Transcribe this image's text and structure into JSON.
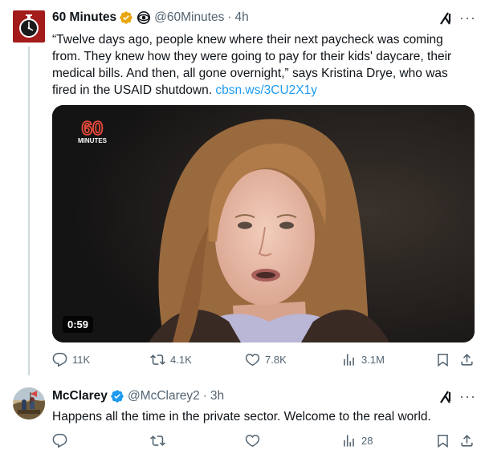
{
  "tweets": [
    {
      "display_name": "60 Minutes",
      "handle": "@60Minutes",
      "separator": "·",
      "time": "4h",
      "text": "“Twelve days ago, people knew where their next paycheck was coming from. They knew how they were going to pay for their kids' daycare, their medical bills. And then, all gone overnight,” says Kristina Drye, who was fired in the USAID shutdown. ",
      "link": "cbsn.ws/3CU2X1y",
      "video": {
        "duration": "0:59",
        "brand_line1": "60",
        "brand_line2": "MINUTES"
      },
      "stats": {
        "replies": "11K",
        "reposts": "4.1K",
        "likes": "7.8K",
        "views": "3.1M"
      },
      "badge_color": "#e8a711",
      "avatar_icon": "stopwatch-logo"
    },
    {
      "display_name": "McClarey",
      "handle": "@McClarey2",
      "separator": "·",
      "time": "3h",
      "text": "Happens all the time in the private sector.  Welcome to the real world.",
      "stats": {
        "replies": "",
        "reposts": "",
        "likes": "",
        "views": "28"
      },
      "badge_color": "#1d9bf0",
      "avatar_icon": "painting-avatar"
    }
  ],
  "more_label": "···",
  "colors": {
    "accent": "#1d9bf0",
    "muted": "#536471",
    "text": "#0f1419"
  }
}
